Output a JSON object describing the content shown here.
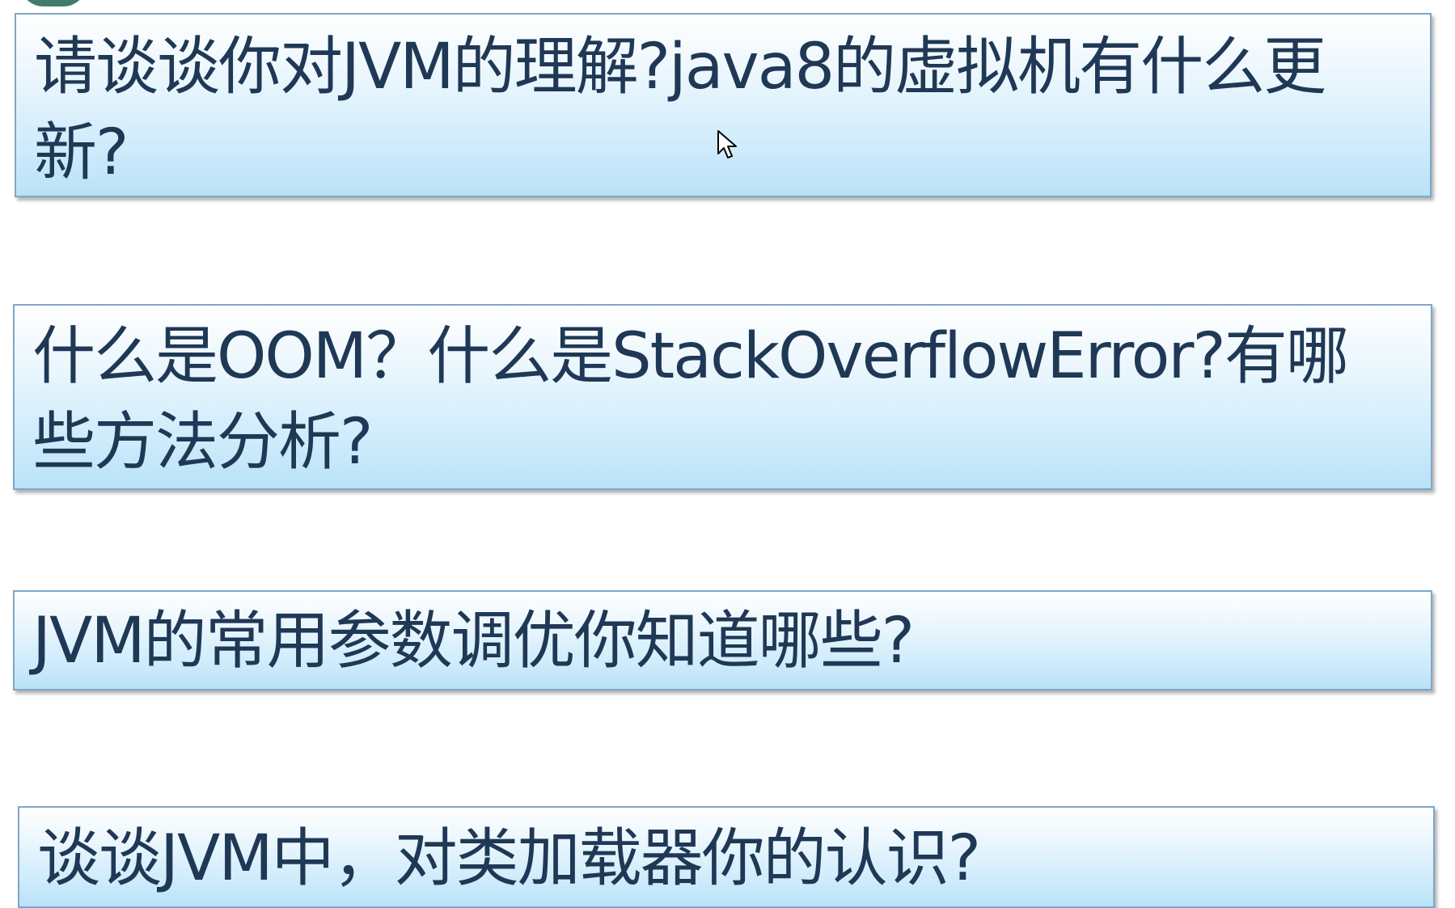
{
  "slide": {
    "questions": [
      {
        "text": "请谈谈你对JVM的理解?java8的虚拟机有什么更新?"
      },
      {
        "text": "什么是OOM？什么是StackOverflowError?有哪些方法分析?"
      },
      {
        "text": "JVM的常用参数调优你知道哪些?"
      },
      {
        "text": "谈谈JVM中，对类加载器你的认识?"
      }
    ]
  },
  "colors": {
    "text": "#1f3855",
    "box_border": "#7fa6c8",
    "box_gradient_top": "#ffffff",
    "box_gradient_bottom": "#b9e2f8",
    "corner_circle": "#3f7d6a"
  }
}
